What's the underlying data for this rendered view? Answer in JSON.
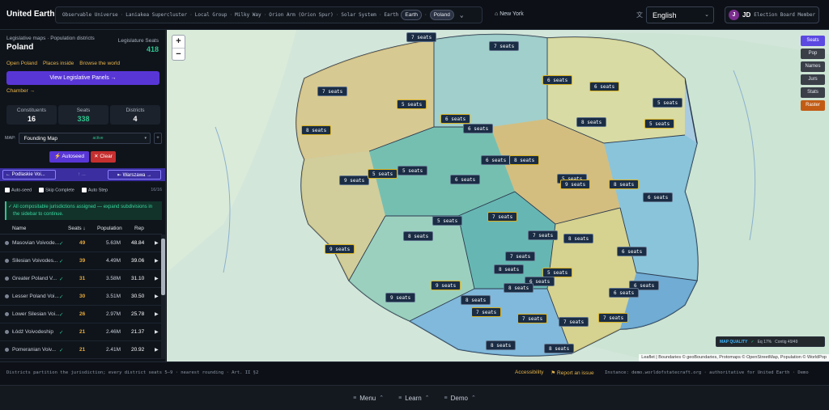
{
  "header": {
    "brand": "United Earth - Demo",
    "breadcrumbs": [
      "Observable Universe",
      "Laniakea Supercluster",
      "Local Group",
      "Milky Way",
      "Orion Arm (Orion Spur)",
      "Solar System",
      "Earth"
    ],
    "crumb_pills": [
      "Earth",
      "Poland"
    ],
    "separator": "·",
    "location": "New York",
    "language": "English",
    "user_initial": "J",
    "user_initials": "JD",
    "user_role": "Election Board Member"
  },
  "sidebar": {
    "subtitle": "Legislative maps · Population districts",
    "title": "Poland",
    "seats_label": "Legislature Seats",
    "seats_value": "418",
    "links": [
      "Open Poland",
      "Places inside",
      "Browse the world"
    ],
    "panels_button": "View Legislative Panels →",
    "chamber_link": "Chamber →",
    "stats": [
      {
        "label": "Constituents",
        "value": "16"
      },
      {
        "label": "Seats",
        "value": "338"
      },
      {
        "label": "Districts",
        "value": "4"
      }
    ],
    "map_label": "MAP:",
    "map_select": "Founding Map",
    "map_status": "active",
    "autoseed_button": "Autoseed",
    "clear_button": "Clear",
    "nav_prev": "← Podlaskie Voi...",
    "nav_mid": "↑ ...",
    "nav_next": "⇤ Warszawa →",
    "checks": [
      "Auto-seed",
      "Skip Complete",
      "Auto Step"
    ],
    "check_count": "16/16",
    "notice": "All compositable jurisdictions assigned — expand subdivisions in the sidebar to continue.",
    "table_headers": [
      "Name",
      "Seats ↓",
      "Population",
      "Rep"
    ],
    "rows": [
      {
        "name": "Masovian Voivode...",
        "seats": "49",
        "population": "5.63M",
        "rep": "48.84"
      },
      {
        "name": "Silesian Voivodes...",
        "seats": "39",
        "population": "4.49M",
        "rep": "39.06"
      },
      {
        "name": "Greater Poland V...",
        "seats": "31",
        "population": "3.58M",
        "rep": "31.10"
      },
      {
        "name": "Lesser Poland Voi...",
        "seats": "30",
        "population": "3.51M",
        "rep": "30.50"
      },
      {
        "name": "Lower Silesian Voi...",
        "seats": "26",
        "population": "2.97M",
        "rep": "25.78"
      },
      {
        "name": "Łódź Voivodeship",
        "seats": "21",
        "population": "2.46M",
        "rep": "21.37"
      },
      {
        "name": "Pomeranian Voiv...",
        "seats": "21",
        "population": "2.41M",
        "rep": "20.92"
      }
    ],
    "check_mark": "✓",
    "row_play": "▶"
  },
  "map": {
    "zoom_in": "+",
    "zoom_out": "−",
    "layer_buttons": [
      "Seats",
      "Pop",
      "Names",
      "Jurs",
      "Stats",
      "Raster"
    ],
    "seat_labels": [
      "7 seats",
      "7 seats",
      "7 seats",
      "5 seats",
      "6 seats",
      "6 seats",
      "5 seats",
      "8 seats",
      "6 seats",
      "6 seats",
      "8 seats",
      "5 seats",
      "6 seats",
      "8 seats",
      "9 seats",
      "5 seats",
      "5 seats",
      "6 seats",
      "5 seats",
      "9 seats",
      "8 seats",
      "6 seats",
      "5 seats",
      "7 seats",
      "8 seats",
      "7 seats",
      "8 seats",
      "9 seats",
      "7 seats",
      "6 seats",
      "8 seats",
      "5 seats",
      "6 seats",
      "9 seats",
      "8 seats",
      "6 seats",
      "6 seats",
      "9 seats",
      "8 seats",
      "7 seats",
      "7 seats",
      "7 seats",
      "7 seats",
      "8 seats",
      "8 seats"
    ],
    "quality_label": "MAP QUALITY",
    "quality_eq": "Eq 17%",
    "quality_contig": "Contig 49/49",
    "attribution": "Leaflet | Boundaries © geoBoundaries, Protomaps © OpenStreetMap, Population © WorldPop"
  },
  "footer": {
    "status_left": "Districts partition the jurisdiction; every district seats 5–9 · nearest rounding · Art. II §2",
    "links": [
      "Accessibility",
      "Report an issue"
    ],
    "status_right": "Instance: demo.worldofstatecraft.org · authoritative for United Earth · Demo",
    "nav": [
      "Menu",
      "Learn",
      "Demo"
    ]
  },
  "colors": {
    "accent": "#5836d6",
    "success": "#2fc38d",
    "warning": "#e5b24a",
    "danger": "#c62f2f"
  }
}
